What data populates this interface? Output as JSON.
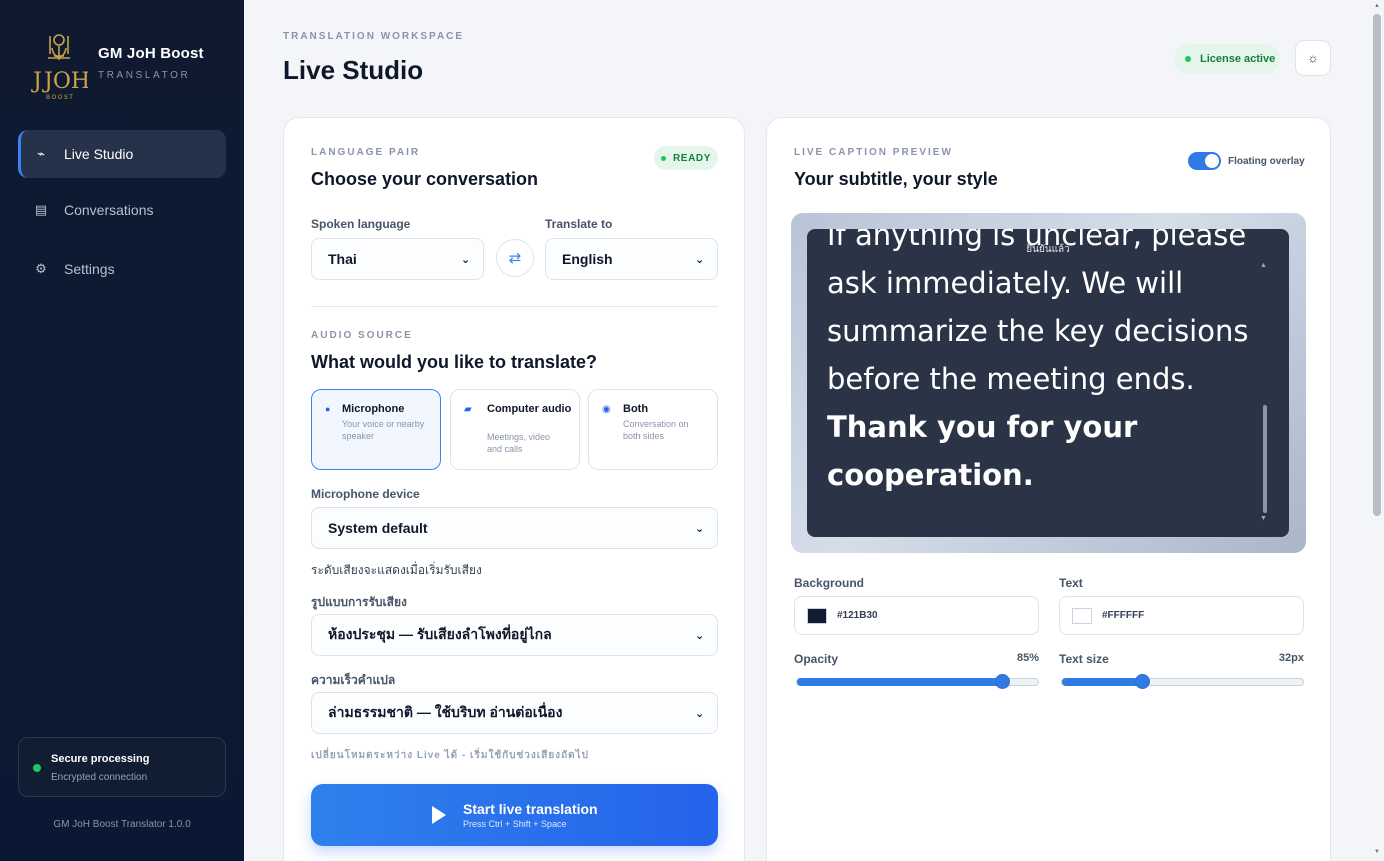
{
  "brand": {
    "name": "GM JoH Boost",
    "subtitle": "TRANSLATOR",
    "logo_text": "JOH",
    "logo_sub": "BOOST"
  },
  "sidebar": {
    "items": [
      {
        "label": "Live Studio",
        "icon": "activity-icon",
        "active": true
      },
      {
        "label": "Conversations",
        "icon": "list-icon",
        "active": false
      },
      {
        "label": "Settings",
        "icon": "gear-icon",
        "active": false
      }
    ],
    "secure": {
      "title": "Secure processing",
      "subtitle": "Encrypted connection"
    },
    "version": "GM JoH Boost Translator 1.0.0"
  },
  "header": {
    "eyebrow": "TRANSLATION WORKSPACE",
    "title": "Live Studio",
    "license": "License active"
  },
  "language": {
    "eyebrow": "LANGUAGE PAIR",
    "title": "Choose your conversation",
    "status": "READY",
    "spoken_label": "Spoken language",
    "spoken_value": "Thai",
    "target_label": "Translate to",
    "target_value": "English"
  },
  "audio": {
    "eyebrow": "AUDIO SOURCE",
    "title": "What would you like to translate?",
    "sources": [
      {
        "title": "Microphone",
        "desc": "Your voice or nearby speaker",
        "selected": true
      },
      {
        "title": "Computer audio",
        "desc": "Meetings, video and calls",
        "selected": false
      },
      {
        "title": "Both",
        "desc": "Conversation on both sides",
        "selected": false
      }
    ],
    "device_label": "Microphone device",
    "device_value": "System default",
    "level_hint": "ระดับเสียงจะแสดงเมื่อเริ่มรับเสียง",
    "capture_label": "รูปแบบการรับเสียง",
    "capture_value": "ห้องประชุม — รับเสียงลำโพงที่อยู่ไกล",
    "speed_label": "ความเร็วคำแปล",
    "speed_value": "ล่ามธรรมชาติ — ใช้บริบท อ่านต่อเนื่อง",
    "mode_hint": "เปลี่ยนโหมดระหว่าง Live ได้ - เริ่มใช้กับช่วงเสียงถัดไป"
  },
  "start": {
    "label": "Start live translation",
    "shortcut": "Press Ctrl + Shift + Space"
  },
  "preview": {
    "eyebrow": "LIVE CAPTION PREVIEW",
    "title": "Your subtitle, your style",
    "overlay_label": "Floating overlay",
    "overlay_on": true,
    "caption_header": "ยืนยันแล้ว",
    "caption_lines": [
      "If anything is unclear, please",
      "ask immediately. We will",
      "summarize the key decisions",
      "before the meeting ends.",
      "Thank you for your",
      "cooperation."
    ],
    "background_label": "Background",
    "background_value": "#121B30",
    "text_label": "Text",
    "text_value": "#FFFFFF",
    "opacity_label": "Opacity",
    "opacity_value": "85%",
    "opacity_fraction": 0.85,
    "size_label": "Text size",
    "size_value": "32px",
    "size_fraction": 0.33
  },
  "colors": {
    "accent": "#2563EB",
    "sidebar": "#0F1A30",
    "success": "#22C55E"
  }
}
